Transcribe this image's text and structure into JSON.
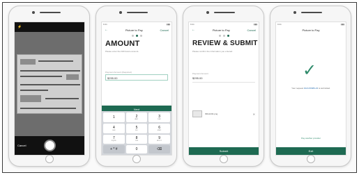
{
  "status_bar": {
    "time": "9:41"
  },
  "screen1": {
    "flash": "⚡",
    "cancel_label": "Cancel"
  },
  "screen2": {
    "nav_title": "Picture to Pay",
    "nav_cancel": "Cancel",
    "heading": "AMOUNT",
    "subtext": "Please enter the bill/invoice amount.",
    "field_label": "Payment Amount (Required)",
    "field_value": "$295.00",
    "next_label": "Next",
    "keys": [
      {
        "num": "1",
        "letters": ""
      },
      {
        "num": "2",
        "letters": "ABC"
      },
      {
        "num": "3",
        "letters": "DEF"
      },
      {
        "num": "4",
        "letters": "GHI"
      },
      {
        "num": "5",
        "letters": "JKL"
      },
      {
        "num": "6",
        "letters": "MNO"
      },
      {
        "num": "7",
        "letters": "PQRS"
      },
      {
        "num": "8",
        "letters": "TUV"
      },
      {
        "num": "9",
        "letters": "WXYZ"
      },
      {
        "num": "+ * #",
        "letters": ""
      },
      {
        "num": "0",
        "letters": ""
      },
      {
        "num": "⌫",
        "letters": ""
      }
    ]
  },
  "screen3": {
    "nav_title": "Picture to Pay",
    "nav_cancel": "Cancel",
    "heading": "REVIEW & SUBMIT",
    "subtext": "Please confirm the information you entered.",
    "amount_label": "Payment Amount",
    "amount_value": "$295.00",
    "file_name": "IMG1234.png",
    "submit_label": "Submit"
  },
  "screen4": {
    "nav_title": "Picture to Pay",
    "success_prefix": "Your request",
    "request_id": "#124-56689-23",
    "success_suffix": "is submitted.",
    "link_label": "Pay another provider",
    "exit_label": "Exit"
  },
  "colors": {
    "accent": "#1e6a52",
    "success": "#2e8a6a",
    "link": "#2b6fb0"
  }
}
